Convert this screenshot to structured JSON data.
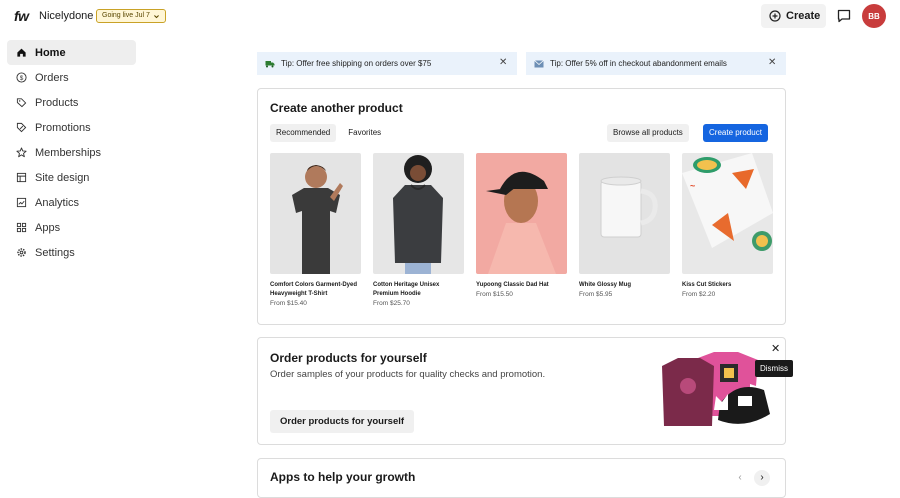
{
  "app": {
    "logo": "fw",
    "store_name": "Nicelydone",
    "golive_badge": "Going live Jul 7",
    "create_label": "Create",
    "avatar_initials": "BB"
  },
  "sidebar": {
    "items": [
      {
        "label": "Home",
        "icon": "home-icon",
        "active": true
      },
      {
        "label": "Orders",
        "icon": "dollar-circle-icon"
      },
      {
        "label": "Products",
        "icon": "tag-icon"
      },
      {
        "label": "Promotions",
        "icon": "discount-tag-icon"
      },
      {
        "label": "Memberships",
        "icon": "star-icon"
      },
      {
        "label": "Site design",
        "icon": "layout-icon"
      },
      {
        "label": "Analytics",
        "icon": "chart-icon"
      },
      {
        "label": "Apps",
        "icon": "apps-grid-icon"
      },
      {
        "label": "Settings",
        "icon": "gear-icon"
      }
    ]
  },
  "tips": [
    {
      "text": "Tip: Offer free shipping on orders over $75",
      "icon": "truck-icon"
    },
    {
      "text": "Tip: Offer 5% off in checkout abandonment emails",
      "icon": "mail-icon"
    }
  ],
  "create_card": {
    "title": "Create another product",
    "tabs": [
      "Recommended",
      "Favorites"
    ],
    "browse_label": "Browse all products",
    "create_label": "Create product",
    "products": [
      {
        "name": "Comfort Colors Garment-Dyed Heavyweight T-Shirt",
        "price": "From $15.40",
        "bg": "#e4e4e4"
      },
      {
        "name": "Cotton Heritage Unisex Premium Hoodie",
        "price": "From $25.70",
        "bg": "#e6e6e6"
      },
      {
        "name": "Yupoong Classic Dad Hat",
        "price": "From $15.50",
        "bg": "#f2a9a2"
      },
      {
        "name": "White Glossy Mug",
        "price": "From $5.95",
        "bg": "#e3e3e3"
      },
      {
        "name": "Kiss Cut Stickers",
        "price": "From $2.20",
        "bg": "#e8e8e8"
      }
    ]
  },
  "order_card": {
    "title": "Order products for yourself",
    "desc": "Order samples of your products for quality checks and promotion.",
    "button": "Order products for yourself",
    "dismiss_tooltip": "Dismiss"
  },
  "apps_card": {
    "title": "Apps to help your growth"
  }
}
